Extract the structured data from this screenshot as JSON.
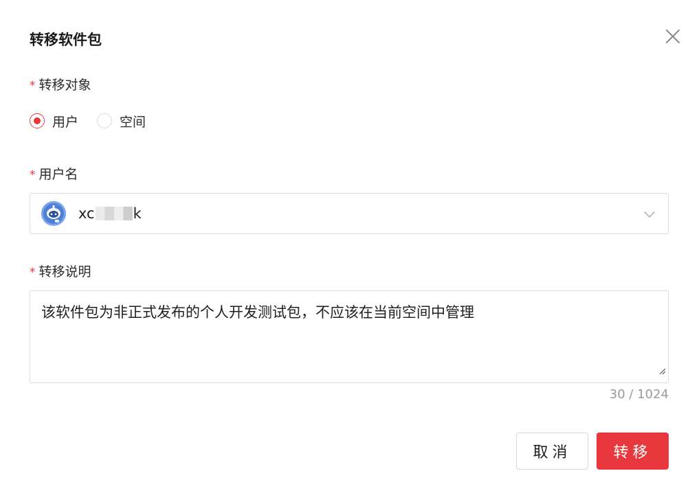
{
  "dialog": {
    "title": "转移软件包",
    "close_icon": "close-icon"
  },
  "target": {
    "required_mark": "*",
    "label": "转移对象",
    "options": [
      {
        "label": "用户",
        "checked": true
      },
      {
        "label": "空间",
        "checked": false
      }
    ]
  },
  "username": {
    "required_mark": "*",
    "label": "用户名",
    "value_prefix": "xc",
    "value_suffix": "k",
    "avatar_icon": "robot-avatar-icon",
    "dropdown_icon": "chevron-down-icon"
  },
  "description": {
    "required_mark": "*",
    "label": "转移说明",
    "value": "该软件包为非正式发布的个人开发测试包，不应该在当前空间中管理",
    "counter": "30 / 1024"
  },
  "actions": {
    "cancel_label": "取消",
    "confirm_label": "转移"
  },
  "colors": {
    "accent": "#e8383d",
    "border": "#dcdcdc",
    "muted_text": "#9a9a9a"
  }
}
